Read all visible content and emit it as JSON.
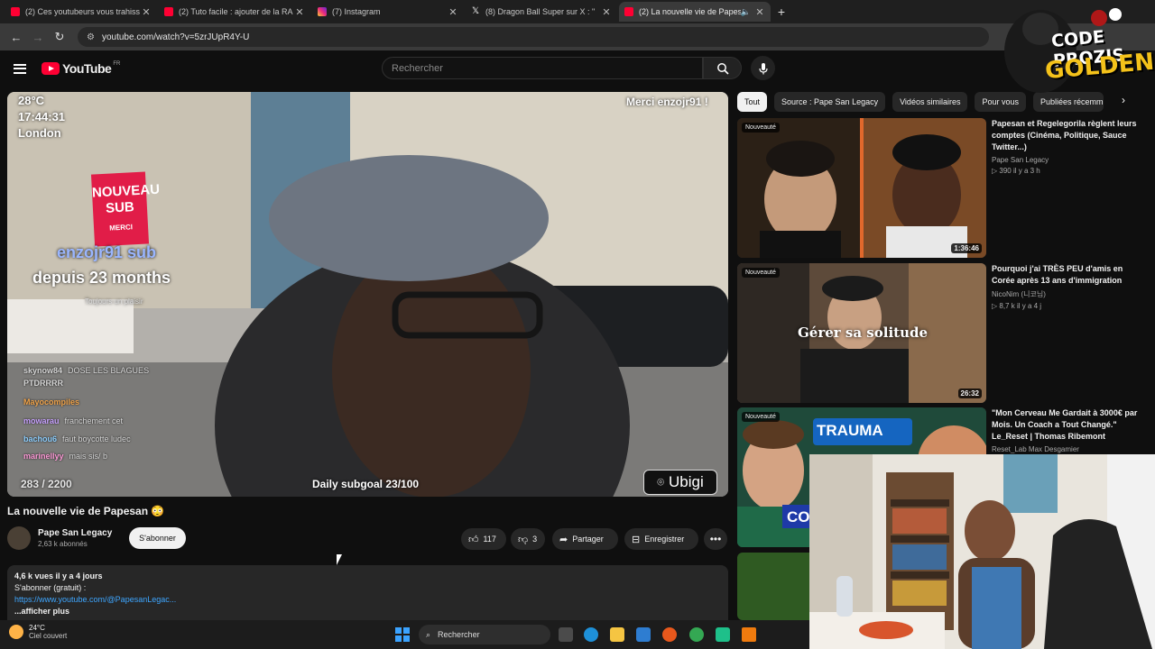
{
  "browser": {
    "tabs": [
      {
        "title": "(2) Ces youtubeurs vous trahiss",
        "icon": "youtube-icon"
      },
      {
        "title": "(2) Tuto facile : ajouter de la RA",
        "icon": "youtube-icon"
      },
      {
        "title": "(7) Instagram",
        "icon": "instagram-icon"
      },
      {
        "title": "(8) Dragon Ball Super sur X : \"",
        "icon": "x-icon"
      },
      {
        "title": "(2) La nouvelle vie de Papes",
        "icon": "youtube-icon",
        "active": true
      }
    ],
    "new_tab": "+",
    "url": "youtube.com/watch?v=5zrJUpR4Y-U"
  },
  "masthead": {
    "logo": "YouTube",
    "country": "FR",
    "search_placeholder": "Rechercher"
  },
  "video": {
    "overlay": {
      "temperature": "28°C",
      "time": "17:44:31",
      "city": "London",
      "thanks": "Merci enzojr91 !",
      "badge_top": "NOUVEAU SUB",
      "badge_bottom": "MERCI",
      "sub_user": "enzojr91 sub",
      "sub_since": "depuis 23 months",
      "sub_faint": "Toujours un plaisir",
      "counter": "283 / 2200",
      "subgoal": "Daily subgoal 23/100",
      "sponsor": "Ubigi"
    },
    "chat": [
      {
        "user": "skynow84",
        "msg": "DOSE LES BLAGUES"
      },
      {
        "user": "PTDRRRR",
        "msg": ""
      },
      {
        "user": "Mayocompiles",
        "msg": ""
      },
      {
        "user": "mowarau",
        "msg": "franchement cet"
      },
      {
        "user": "bachou6",
        "msg": "faut boycotte ludec"
      },
      {
        "user": "marinellyy",
        "msg": "mais sis/ b"
      }
    ]
  },
  "info": {
    "title": "La nouvelle vie de Papesan 😳",
    "channel": "Pape San Legacy",
    "subscribers": "2,63 k abonnés",
    "subscribe": "S'abonner",
    "likes": "117",
    "dislikes": "3",
    "share": "Partager",
    "save": "Enregistrer",
    "views": "4,6 k vues  il y a 4 jours",
    "desc_line1": "S'abonner (gratuit) :",
    "desc_link": "https://www.youtube.com/@PapesanLegac...",
    "show_more": "...afficher plus"
  },
  "chips": [
    "Tout",
    "Source : Pape San Legacy",
    "Vidéos similaires",
    "Pour vous",
    "Publiées récemm"
  ],
  "recommendations": [
    {
      "badge": "Nouveauté",
      "duration": "1:36:46",
      "title": "Papesan et Regelegorila règlent leurs comptes (Cinéma, Politique, Sauce Twitter...)",
      "channel": "Pape San Legacy",
      "stats": "▷ 390  il y a 3 h"
    },
    {
      "badge": "Nouveauté",
      "duration": "26:32",
      "overlay": "Gérer sa solitude",
      "title": "Pourquoi j'ai TRÈS PEU d'amis en Corée après 13 ans d'immigration",
      "channel": "NicoNim (니코님)",
      "stats": "▷ 8,7 k  il y a 4 j"
    },
    {
      "badge": "Nouveauté",
      "overlay": "TRAUMA",
      "overlay2": "CO",
      "title": "\"Mon Cerveau Me Gardait à 3000€ par Mois. Un Coach a Tout Changé.\" Le_Reset | Thomas Ribemont",
      "channel": "Reset_Lab Max Desgamier",
      "stats": ""
    }
  ],
  "promo": {
    "line1": "CODE PROZIS",
    "line2": "GOLDENG"
  },
  "taskbar": {
    "temp": "24°C",
    "weather": "Ciel couvert",
    "search": "Rechercher"
  }
}
